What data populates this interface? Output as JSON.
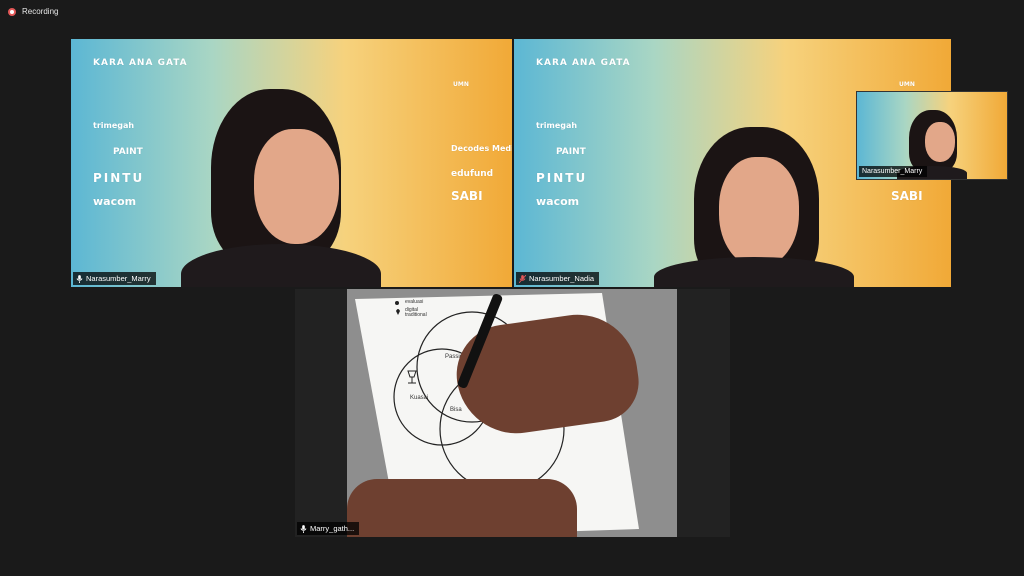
{
  "recording": {
    "label": "Recording"
  },
  "tiles": {
    "marry": {
      "name": "Narasumber_Marry"
    },
    "nadia": {
      "name": "Narasumber_Nadia"
    },
    "marry_pip": {
      "name": "Narasumber_Marry"
    },
    "drawing": {
      "name": "Marry_gath..."
    }
  },
  "backdrop_logos": {
    "left": [
      "KARA ANA GATA",
      "trimegah",
      "PAINT",
      "PINTU",
      "wacom"
    ],
    "right": [
      "UMN",
      "Decodes Media",
      "edufund",
      "SABI"
    ]
  },
  "drawing_notes": {
    "legend_1": "evaluasi",
    "legend_2": "digital traditional",
    "label_a": "Passion",
    "label_b": "Kuasai",
    "label_c": "Bisa"
  },
  "colors": {
    "background": "#1a1a1a",
    "active_speaker_border": "#d9e68a",
    "recording_dot": "#e45858"
  }
}
